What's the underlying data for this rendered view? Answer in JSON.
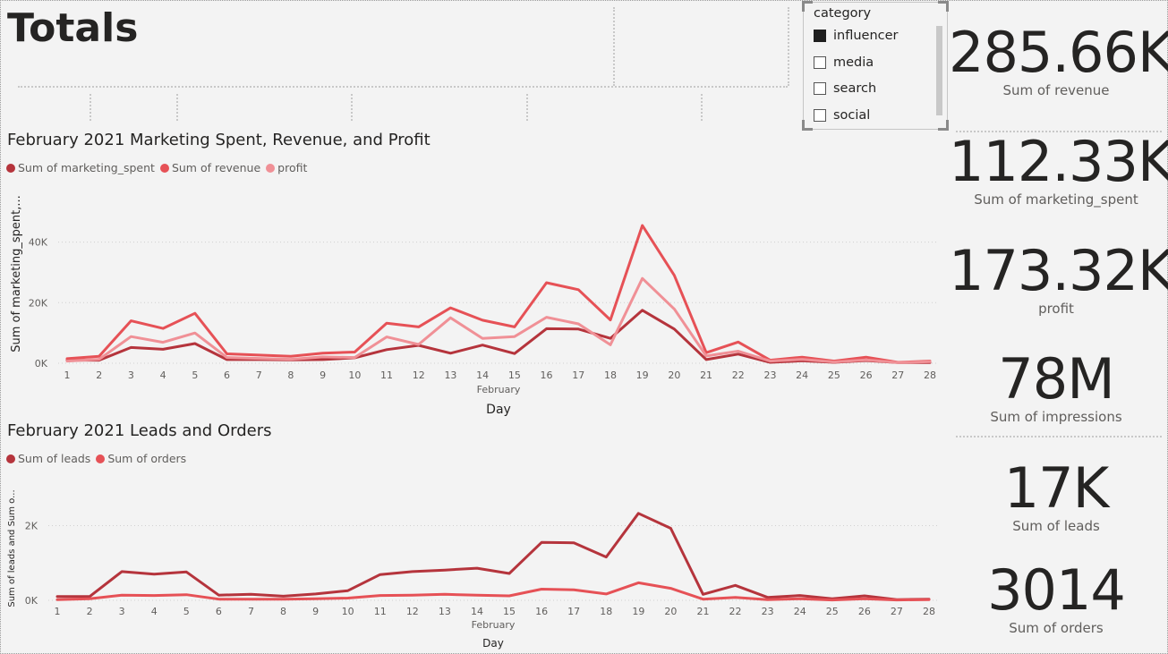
{
  "page": {
    "title": "Totals"
  },
  "slicer": {
    "header": "category",
    "options": [
      {
        "label": "influencer",
        "checked": true
      },
      {
        "label": "media",
        "checked": false
      },
      {
        "label": "search",
        "checked": false
      },
      {
        "label": "social",
        "checked": false
      }
    ]
  },
  "kpis": [
    {
      "value": "285.66K",
      "label": "Sum of revenue"
    },
    {
      "value": "112.33K",
      "label": "Sum of marketing_spent"
    },
    {
      "value": "173.32K",
      "label": "profit"
    },
    {
      "value": "78M",
      "label": "Sum of impressions"
    },
    {
      "value": "17K",
      "label": "Sum of leads"
    },
    {
      "value": "3014",
      "label": "Sum of orders"
    }
  ],
  "chart_data": [
    {
      "type": "line",
      "title": "February 2021 Marketing Spent, Revenue, and Profit",
      "xlabel": "Day",
      "xsublabel": "February",
      "ylabel": "Sum of marketing_spent,...",
      "x": [
        1,
        2,
        3,
        4,
        5,
        6,
        7,
        8,
        9,
        10,
        11,
        12,
        13,
        14,
        15,
        16,
        17,
        18,
        19,
        20,
        21,
        22,
        23,
        24,
        25,
        26,
        27,
        28
      ],
      "yticks": [
        "0K",
        "20K",
        "40K"
      ],
      "yticks_values": [
        0,
        20000,
        40000
      ],
      "ylim": [
        0,
        52000
      ],
      "legend_position": "top-left",
      "series": [
        {
          "name": "Sum of marketing_spent",
          "color": "#b5343c",
          "values": [
            1000,
            1000,
            5200,
            4600,
            6500,
            1200,
            1200,
            1100,
            1200,
            1800,
            4500,
            5900,
            3300,
            6000,
            3200,
            11400,
            11300,
            8200,
            17500,
            11300,
            1200,
            3000,
            300,
            800,
            300,
            900,
            200,
            200
          ]
        },
        {
          "name": "Sum of revenue",
          "color": "#e65156",
          "values": [
            1500,
            2300,
            14000,
            11500,
            16500,
            3100,
            2700,
            2300,
            3300,
            3700,
            13200,
            12000,
            18300,
            14200,
            12000,
            26600,
            24300,
            14300,
            45500,
            29000,
            3500,
            7000,
            1000,
            2000,
            700,
            2000,
            300,
            700
          ]
        },
        {
          "name": "profit",
          "color": "#f09096",
          "values": [
            700,
            1300,
            8800,
            6900,
            10000,
            1900,
            1600,
            1300,
            2100,
            1900,
            8700,
            6200,
            15000,
            8200,
            8800,
            15200,
            13000,
            6100,
            28000,
            17900,
            2400,
            4000,
            700,
            1300,
            400,
            1100,
            200,
            500
          ]
        }
      ]
    },
    {
      "type": "line",
      "title": "February 2021 Leads and Orders",
      "xlabel": "Day",
      "xsublabel": "February",
      "ylabel": "Sum of leads and Sum o...",
      "x": [
        1,
        2,
        3,
        4,
        5,
        6,
        7,
        8,
        9,
        10,
        11,
        12,
        13,
        14,
        15,
        16,
        17,
        18,
        19,
        20,
        21,
        22,
        23,
        24,
        25,
        26,
        27,
        28
      ],
      "yticks": [
        "0K",
        "2K"
      ],
      "yticks_values": [
        0,
        2000
      ],
      "ylim": [
        0,
        2900
      ],
      "legend_position": "top-left",
      "series": [
        {
          "name": "Sum of leads",
          "color": "#b5343c",
          "values": [
            100,
            100,
            770,
            700,
            760,
            140,
            160,
            110,
            170,
            260,
            690,
            770,
            810,
            860,
            720,
            1550,
            1540,
            1160,
            2330,
            1930,
            160,
            400,
            80,
            130,
            40,
            120,
            20,
            30
          ]
        },
        {
          "name": "Sum of orders",
          "color": "#e65156",
          "values": [
            20,
            40,
            140,
            130,
            150,
            30,
            30,
            30,
            40,
            60,
            130,
            140,
            160,
            140,
            120,
            300,
            280,
            170,
            470,
            320,
            30,
            80,
            20,
            40,
            10,
            40,
            10,
            20
          ]
        }
      ]
    }
  ]
}
